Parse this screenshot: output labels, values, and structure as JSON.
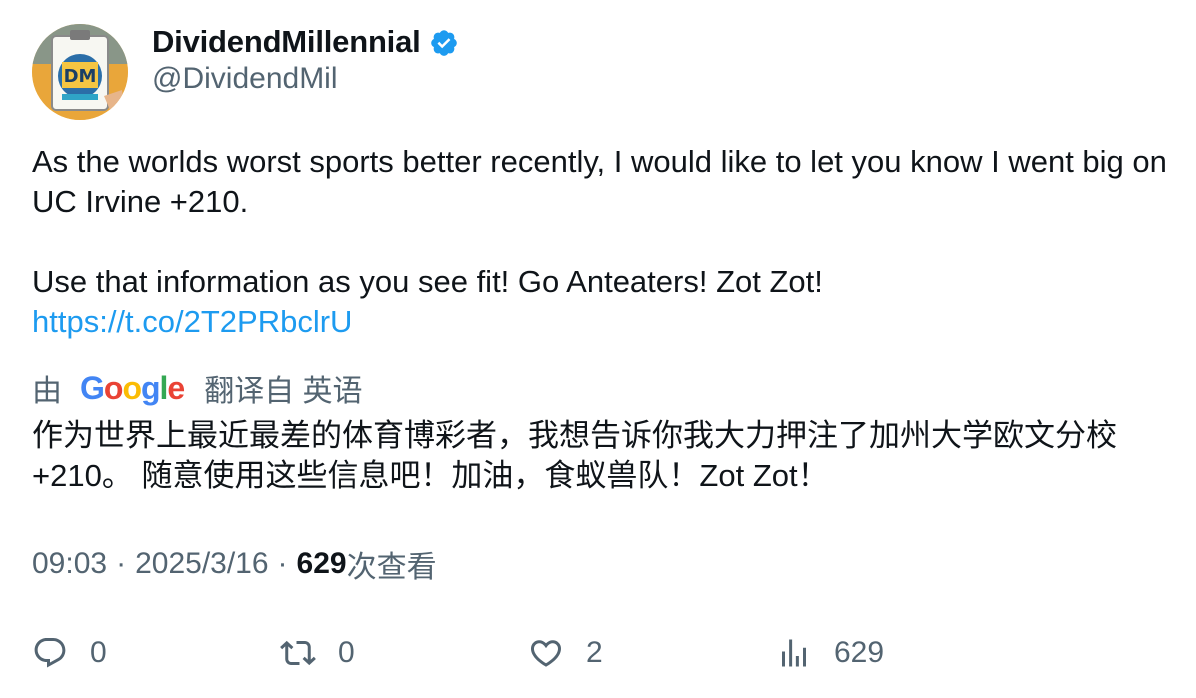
{
  "author": {
    "display_name": "DividendMillennial",
    "handle": "@DividendMil",
    "verified_icon": "verified-badge-icon",
    "avatar_text": "DM"
  },
  "tweet": {
    "line1": "As the worlds worst sports better recently, I would like to let you know I went big on UC Irvine +210.",
    "line2": "Use that information as you see fit!  Go Anteaters! Zot Zot!",
    "link": "https://t.co/2T2PRbclrU"
  },
  "translation": {
    "by_label": "由",
    "provider": "Google",
    "from_label": "翻译自 英语",
    "text": "作为世界上最近最差的体育博彩者，我想告诉你我大力押注了加州大学欧文分校 +210。 随意使用这些信息吧！加油，食蚁兽队！Zot Zot！"
  },
  "meta": {
    "time": "09:03",
    "separator": "·",
    "date": "2025/3/16",
    "views_count": "629",
    "views_label": "次查看"
  },
  "actions": {
    "reply": {
      "icon": "reply-icon",
      "count": "0"
    },
    "retweet": {
      "icon": "retweet-icon",
      "count": "0"
    },
    "like": {
      "icon": "heart-icon",
      "count": "2"
    },
    "views": {
      "icon": "analytics-icon",
      "count": "629"
    }
  },
  "colors": {
    "link": "#1d9bf0",
    "secondary_text": "#536471",
    "verified": "#1d9bf0"
  }
}
